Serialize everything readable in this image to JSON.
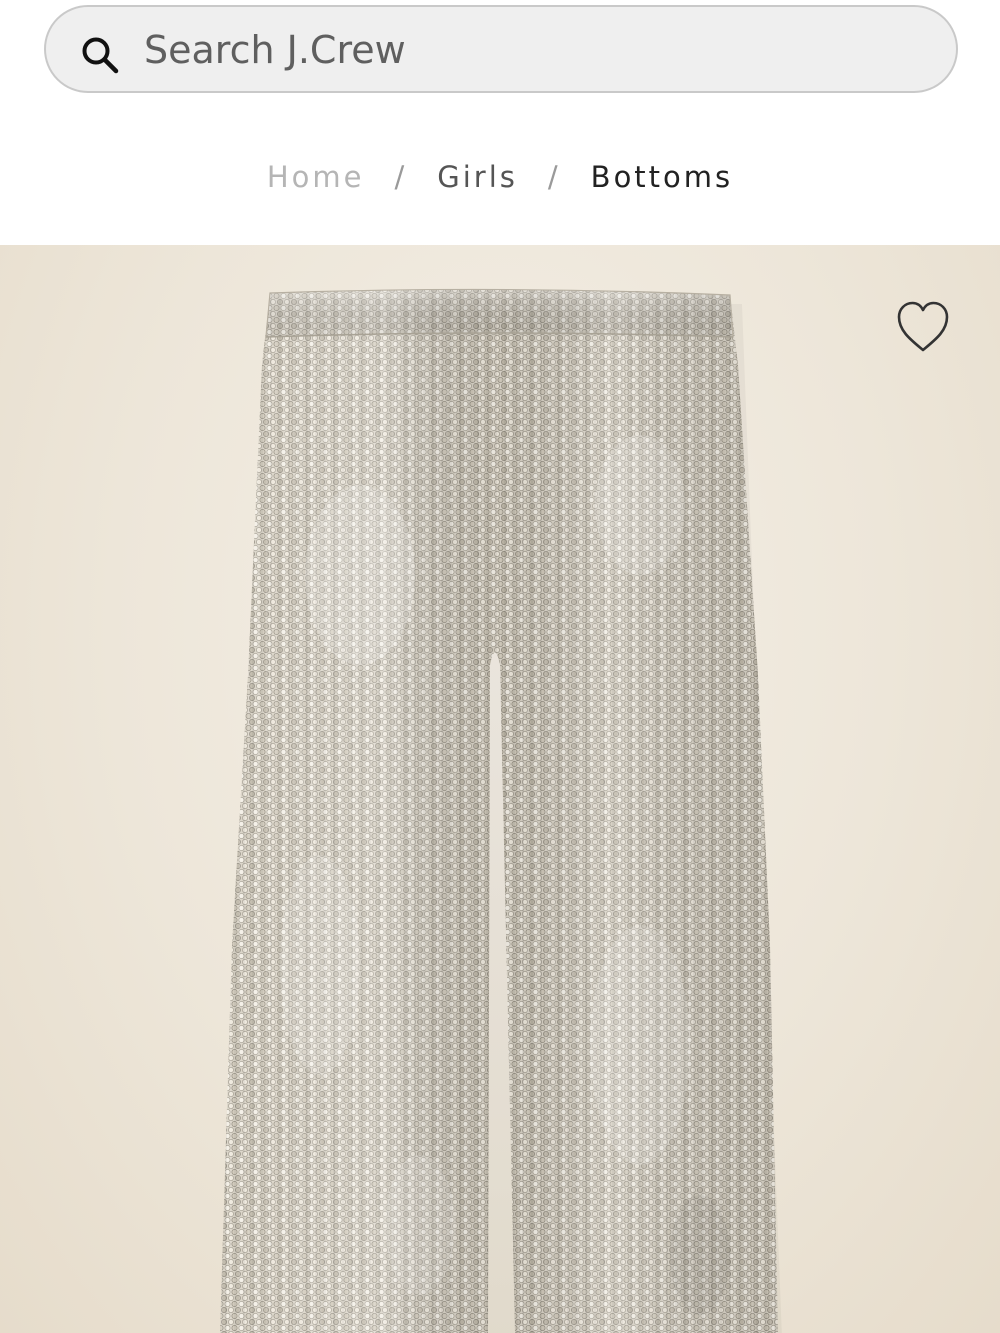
{
  "search": {
    "placeholder": "Search J.Crew",
    "value": "",
    "icon": "search-icon"
  },
  "breadcrumb": {
    "items": [
      {
        "label": "Home"
      },
      {
        "label": "Girls"
      },
      {
        "label": "Bottoms"
      }
    ],
    "separator": "/"
  },
  "product": {
    "image_subject": "sequin pants",
    "wishlist_icon": "heart-icon"
  },
  "colors": {
    "image_background": "#ede6d9",
    "search_background": "#efefef"
  }
}
